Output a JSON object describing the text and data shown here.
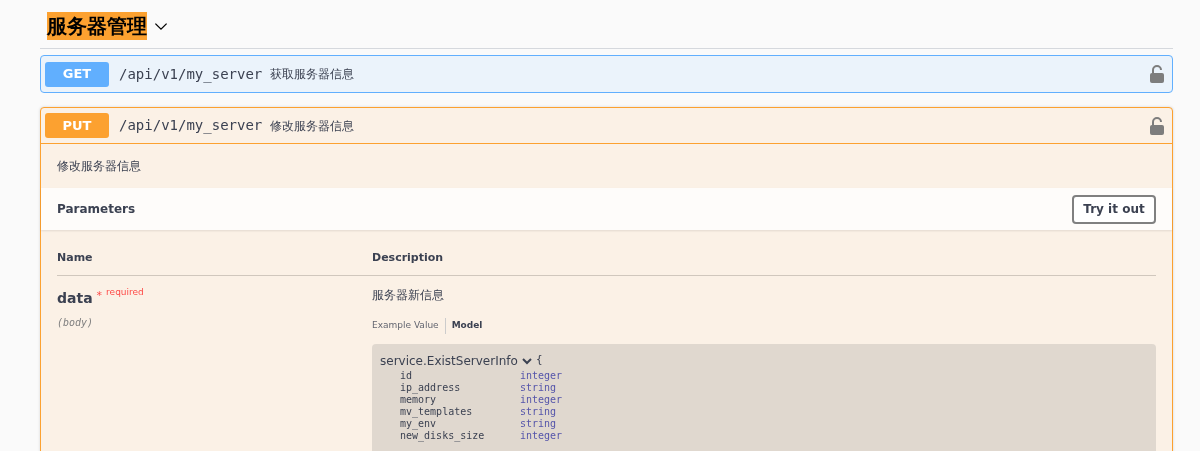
{
  "section": {
    "title": "服务器管理",
    "expanded": true
  },
  "operations": [
    {
      "method": "GET",
      "path": "/api/v1/my_server",
      "summary": "获取服务器信息",
      "expanded": false
    },
    {
      "method": "PUT",
      "path": "/api/v1/my_server",
      "summary": "修改服务器信息",
      "expanded": true,
      "description": "修改服务器信息",
      "parameters": {
        "title": "Parameters",
        "try_button": "Try it out",
        "columns": [
          "Name",
          "Description"
        ],
        "rows": [
          {
            "name": "data",
            "required_mark": "*",
            "required": "required",
            "location": "(body)",
            "description": "服务器新信息",
            "tabs": [
              {
                "label": "Example Value",
                "selected": false
              },
              {
                "label": "Model",
                "selected": true
              }
            ],
            "model": {
              "name": "service.ExistServerInfo",
              "open_brace": "{",
              "expanded": true,
              "fields": [
                {
                  "name": "id",
                  "type": "integer"
                },
                {
                  "name": "ip_address",
                  "type": "string"
                },
                {
                  "name": "memory",
                  "type": "integer"
                },
                {
                  "name": "mv_templates",
                  "type": "string"
                },
                {
                  "name": "my_env",
                  "type": "string"
                },
                {
                  "name": "new_disks_size",
                  "type": "integer"
                }
              ]
            }
          }
        ]
      }
    }
  ]
}
